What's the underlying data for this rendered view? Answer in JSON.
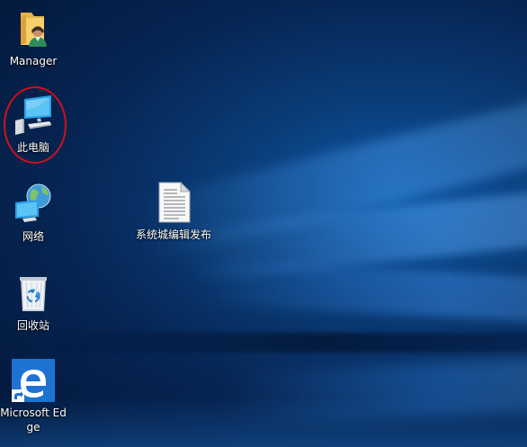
{
  "desktop": {
    "icons": [
      {
        "label": "Manager",
        "icon": "folder-user-icon"
      },
      {
        "label": "此电脑",
        "icon": "this-pc-icon"
      },
      {
        "label": "网络",
        "icon": "network-icon"
      },
      {
        "label": "回收站",
        "icon": "recycle-bin-icon"
      },
      {
        "label": "Microsoft Edge",
        "icon": "edge-icon"
      },
      {
        "label": "系统城编辑发布",
        "icon": "text-document-icon"
      }
    ]
  },
  "colors": {
    "highlight_ring": "#d0101a",
    "wallpaper_primary": "#0a3c78",
    "edge_tile": "#1e73d2"
  }
}
